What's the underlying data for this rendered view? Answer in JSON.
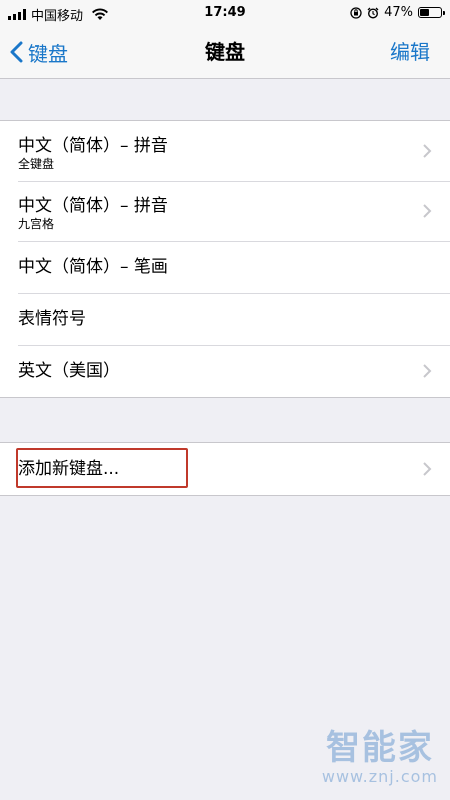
{
  "status_bar": {
    "carrier": "中国移动",
    "time": "17:49",
    "battery_percent": "47%",
    "battery_level": 0.47
  },
  "nav": {
    "back_label": "键盘",
    "title": "键盘",
    "edit_label": "编辑"
  },
  "keyboards": [
    {
      "title": "中文（简体）– 拼音",
      "subtitle": "全键盘",
      "chevron": true
    },
    {
      "title": "中文（简体）– 拼音",
      "subtitle": "九宫格",
      "chevron": true
    },
    {
      "title": "中文（简体）– 笔画",
      "chevron": false
    },
    {
      "title": "表情符号",
      "chevron": false
    },
    {
      "title": "英文（美国）",
      "chevron": true
    }
  ],
  "add_keyboard": {
    "label": "添加新键盘..."
  },
  "watermark": {
    "logo": "智能家",
    "url": "www.znj.com"
  },
  "colors": {
    "accent": "#1a77c9",
    "highlight": "#c0392b",
    "background": "#efeff4"
  }
}
